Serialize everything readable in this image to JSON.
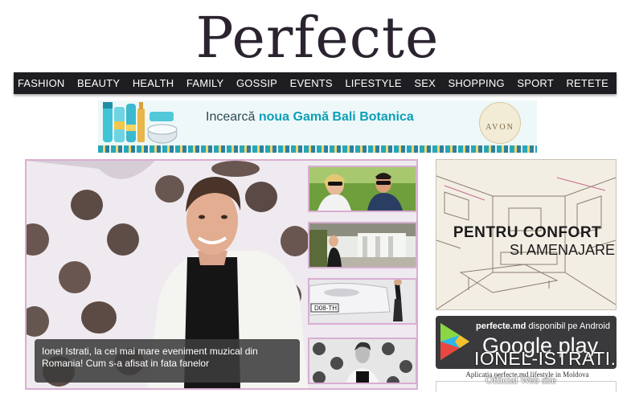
{
  "site": {
    "logo": "Perfecte"
  },
  "nav": {
    "items": [
      "FASHION",
      "BEAUTY",
      "HEALTH",
      "FAMILY",
      "GOSSIP",
      "EVENTS",
      "LIFESTYLE",
      "SEX",
      "SHOPPING",
      "SPORT",
      "RETETE"
    ]
  },
  "banner": {
    "text_plain": "Incearcă",
    "text_bold": "noua Gamă Bali Botanica",
    "brand": "AVON"
  },
  "featured": {
    "caption": "Ionel Istrati, la cel mai mare eveniment muzical din Romania! Cum s-a afisat in fata fanelor"
  },
  "thumbnails": [
    {
      "name": "thumb-couple-sunglasses"
    },
    {
      "name": "thumb-woman-park"
    },
    {
      "name": "thumb-car-plate",
      "plate": "D08-TH"
    },
    {
      "name": "thumb-polka-dot-man"
    }
  ],
  "ads": {
    "interior": {
      "line1": "PENTRU CONFORT",
      "line2": "SI AMENAJARE"
    },
    "android": {
      "line1_bold": "perfecte.md",
      "line1_rest": "disponibil pe Android",
      "store": "Google play",
      "caption": "Aplicatia perfecte.md lifestyle in Moldova"
    }
  },
  "watermark": {
    "title": "IONEL-ISTRATI.COM",
    "subtitle": "Official Web site"
  },
  "colors": {
    "nav_bg": "#1e1e22",
    "frame": "#d9aed2",
    "banner_accent": "#0b9fb8",
    "logo": "#2b2430"
  }
}
